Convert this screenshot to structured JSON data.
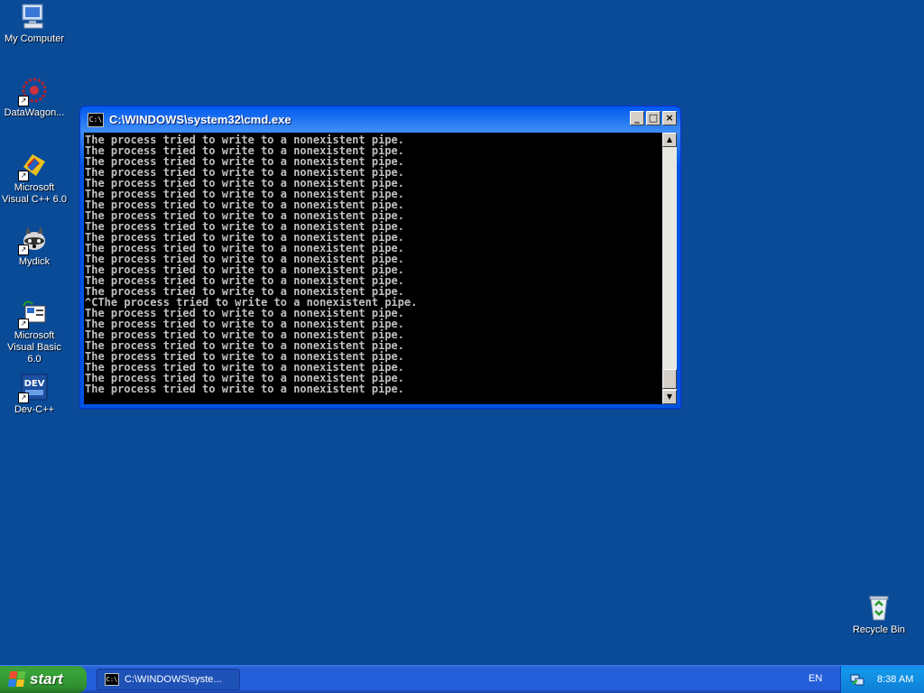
{
  "desktop": {
    "icons": [
      {
        "label": "My Computer"
      },
      {
        "label": "DataWagon..."
      },
      {
        "label": "Microsoft Visual C++ 6.0"
      },
      {
        "label": "Mydick"
      },
      {
        "label": "Microsoft Visual Basic 6.0"
      },
      {
        "label": "Dev-C++"
      },
      {
        "label": "Recycle Bin"
      }
    ],
    "background_color": "#0a4b98"
  },
  "window": {
    "title": "C:\\WINDOWS\\system32\\cmd.exe",
    "icon_text": "C:\\",
    "buttons": {
      "minimize": "_",
      "maximize": "□",
      "close": "×"
    },
    "console_lines": [
      "The process tried to write to a nonexistent pipe.",
      "The process tried to write to a nonexistent pipe.",
      "The process tried to write to a nonexistent pipe.",
      "The process tried to write to a nonexistent pipe.",
      "The process tried to write to a nonexistent pipe.",
      "The process tried to write to a nonexistent pipe.",
      "The process tried to write to a nonexistent pipe.",
      "The process tried to write to a nonexistent pipe.",
      "The process tried to write to a nonexistent pipe.",
      "The process tried to write to a nonexistent pipe.",
      "The process tried to write to a nonexistent pipe.",
      "The process tried to write to a nonexistent pipe.",
      "The process tried to write to a nonexistent pipe.",
      "The process tried to write to a nonexistent pipe.",
      "The process tried to write to a nonexistent pipe.",
      "^CThe process tried to write to a nonexistent pipe.",
      "The process tried to write to a nonexistent pipe.",
      "The process tried to write to a nonexistent pipe.",
      "The process tried to write to a nonexistent pipe.",
      "The process tried to write to a nonexistent pipe.",
      "The process tried to write to a nonexistent pipe.",
      "The process tried to write to a nonexistent pipe.",
      "The process tried to write to a nonexistent pipe.",
      "The process tried to write to a nonexistent pipe."
    ]
  },
  "taskbar": {
    "start_label": "start",
    "task_button_label": "C:\\WINDOWS\\syste...",
    "language": "EN",
    "clock": "8:38 AM"
  }
}
